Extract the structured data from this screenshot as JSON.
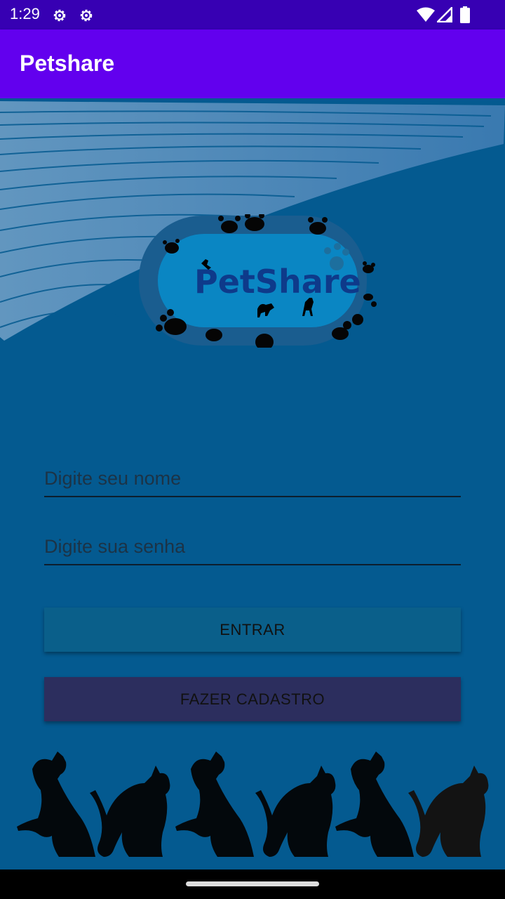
{
  "status_bar": {
    "time": "1:29",
    "icons": [
      "settings-gear-icon",
      "settings-gear-icon",
      "wifi-icon",
      "signal-icon",
      "battery-icon"
    ]
  },
  "app_bar": {
    "title": "Petshare"
  },
  "logo": {
    "text": "PetShare"
  },
  "form": {
    "name_placeholder": "Digite seu nome",
    "password_placeholder": "Digite sua senha"
  },
  "buttons": {
    "entrar": "ENTRAR",
    "cadastro": "FAZER CADASTRO"
  },
  "colors": {
    "status_bar": "#3700b3",
    "app_bar": "#6200ee",
    "background": "#045a90",
    "entrar_button": "#0a5f8a",
    "cadastro_button": "#2c2e5e"
  }
}
